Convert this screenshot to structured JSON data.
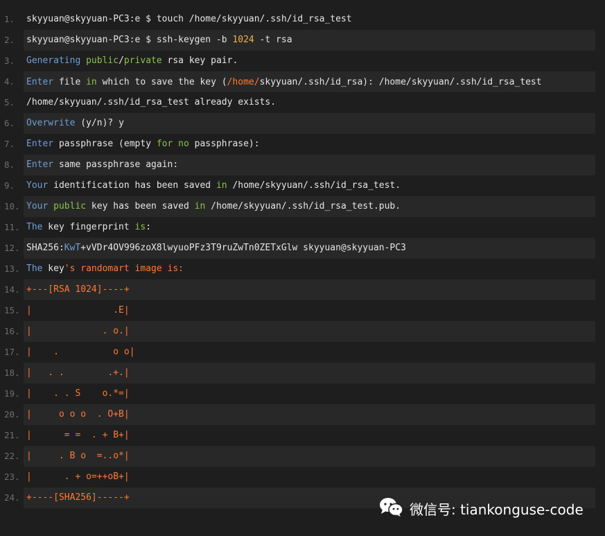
{
  "lines": [
    {
      "n": "1.",
      "alt": false,
      "segs": [
        {
          "t": "skyyuan@skyyuan-PC3:e $ touch /home/skyyuan/.ssh/id_rsa_test"
        }
      ]
    },
    {
      "n": "2.",
      "alt": true,
      "segs": [
        {
          "t": "skyyuan@skyyuan-PC3:e $ ssh-keygen -b "
        },
        {
          "t": "1024",
          "c": "num"
        },
        {
          "t": " -t rsa"
        }
      ]
    },
    {
      "n": "3.",
      "alt": false,
      "segs": [
        {
          "t": "Generating",
          "c": "blue"
        },
        {
          "t": " "
        },
        {
          "t": "public",
          "c": "green"
        },
        {
          "t": "/"
        },
        {
          "t": "private",
          "c": "green"
        },
        {
          "t": " rsa key pair."
        }
      ]
    },
    {
      "n": "4.",
      "alt": true,
      "wrap": true,
      "segs": [
        {
          "t": "Enter",
          "c": "blue"
        },
        {
          "t": " file "
        },
        {
          "t": "in",
          "c": "green"
        },
        {
          "t": " which to save the key ("
        },
        {
          "t": "/home/",
          "c": "orange"
        },
        {
          "t": "skyyuan/.ssh/id_rsa): /home/skyyuan/.ssh/id_rsa_test"
        }
      ]
    },
    {
      "n": "5.",
      "alt": false,
      "segs": [
        {
          "t": "/home/skyyuan/.ssh/id_rsa_test already exists."
        }
      ]
    },
    {
      "n": "6.",
      "alt": true,
      "segs": [
        {
          "t": "Overwrite",
          "c": "blue"
        },
        {
          "t": " (y/n)? y"
        }
      ]
    },
    {
      "n": "7.",
      "alt": false,
      "segs": [
        {
          "t": "Enter",
          "c": "blue"
        },
        {
          "t": " passphrase (empty "
        },
        {
          "t": "for",
          "c": "green"
        },
        {
          "t": " "
        },
        {
          "t": "no",
          "c": "green"
        },
        {
          "t": " passphrase):"
        }
      ]
    },
    {
      "n": "8.",
      "alt": true,
      "segs": [
        {
          "t": "Enter",
          "c": "blue"
        },
        {
          "t": " same passphrase again:"
        }
      ]
    },
    {
      "n": "9.",
      "alt": false,
      "segs": [
        {
          "t": "Your",
          "c": "blue"
        },
        {
          "t": " identification has been saved "
        },
        {
          "t": "in",
          "c": "green"
        },
        {
          "t": " /home/skyyuan/.ssh/id_rsa_test."
        }
      ]
    },
    {
      "n": "10.",
      "alt": true,
      "segs": [
        {
          "t": "Your",
          "c": "blue"
        },
        {
          "t": " "
        },
        {
          "t": "public",
          "c": "green"
        },
        {
          "t": " key has been saved "
        },
        {
          "t": "in",
          "c": "green"
        },
        {
          "t": " /home/skyyuan/.ssh/id_rsa_test.pub."
        }
      ]
    },
    {
      "n": "11.",
      "alt": false,
      "segs": [
        {
          "t": "The",
          "c": "blue"
        },
        {
          "t": " key fingerprint "
        },
        {
          "t": "is",
          "c": "green"
        },
        {
          "t": ":"
        }
      ]
    },
    {
      "n": "12.",
      "alt": true,
      "segs": [
        {
          "t": "SHA256:"
        },
        {
          "t": "KwT",
          "c": "blue"
        },
        {
          "t": "+vVDr4OV996zoX8lwyuoPFz3T9ruZwTn0ZETxGlw skyyuan@skyyuan-PC3"
        }
      ]
    },
    {
      "n": "13.",
      "alt": false,
      "segs": [
        {
          "t": "The",
          "c": "blue"
        },
        {
          "t": " key"
        },
        {
          "t": "'s randomart image is:",
          "c": "orange"
        }
      ]
    },
    {
      "n": "14.",
      "alt": true,
      "segs": [
        {
          "t": "+---[RSA 1024]----+",
          "c": "orange"
        }
      ]
    },
    {
      "n": "15.",
      "alt": false,
      "segs": [
        {
          "t": "|               .E|",
          "c": "orange"
        }
      ]
    },
    {
      "n": "16.",
      "alt": true,
      "segs": [
        {
          "t": "|             . o.|",
          "c": "orange"
        }
      ]
    },
    {
      "n": "17.",
      "alt": false,
      "segs": [
        {
          "t": "|    .          o o|",
          "c": "orange"
        }
      ]
    },
    {
      "n": "18.",
      "alt": true,
      "segs": [
        {
          "t": "|   . .        .+.|",
          "c": "orange"
        }
      ]
    },
    {
      "n": "19.",
      "alt": false,
      "segs": [
        {
          "t": "|    . . S    o.*=|",
          "c": "orange"
        }
      ]
    },
    {
      "n": "20.",
      "alt": true,
      "segs": [
        {
          "t": "|     o o o  . O+B|",
          "c": "orange"
        }
      ]
    },
    {
      "n": "21.",
      "alt": false,
      "segs": [
        {
          "t": "|      = =  . + B+|",
          "c": "orange"
        }
      ]
    },
    {
      "n": "22.",
      "alt": true,
      "segs": [
        {
          "t": "|     . B o  =..o*|",
          "c": "orange"
        }
      ]
    },
    {
      "n": "23.",
      "alt": false,
      "segs": [
        {
          "t": "|      . + o=++oB+|",
          "c": "orange"
        }
      ]
    },
    {
      "n": "24.",
      "alt": true,
      "segs": [
        {
          "t": "+----[SHA256]-----+",
          "c": "orange"
        }
      ]
    }
  ],
  "watermark": {
    "text": "微信号: tiankonguse-code",
    "icon": "wechat-icon"
  }
}
